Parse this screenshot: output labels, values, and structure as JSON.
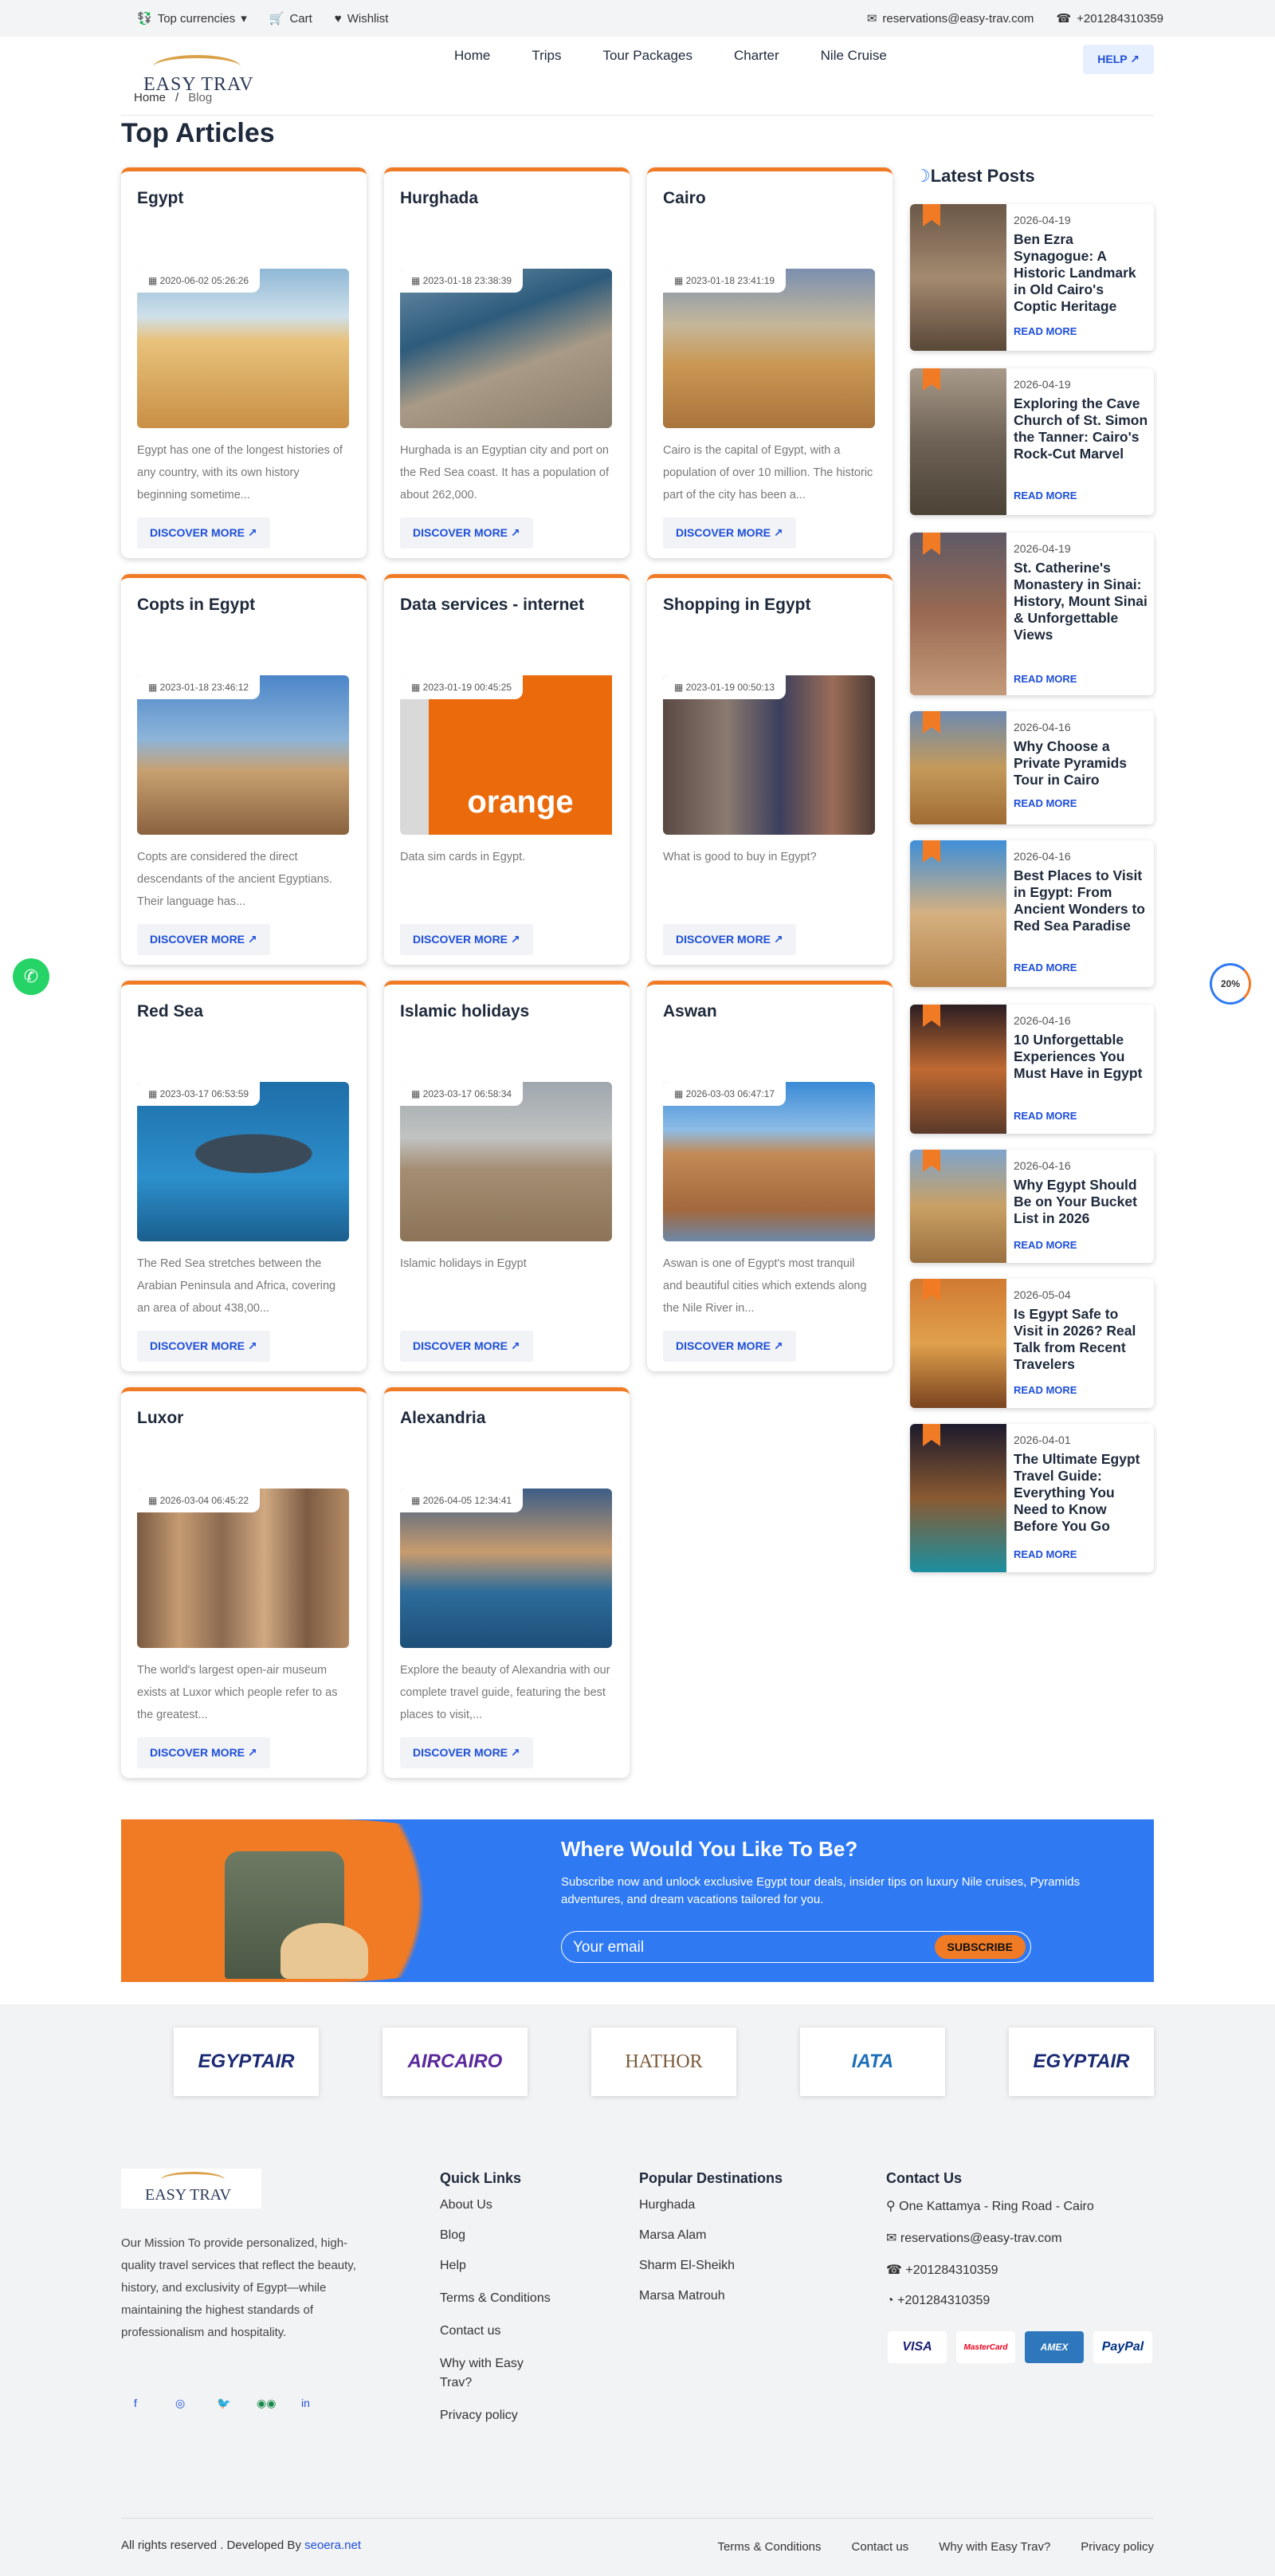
{
  "topbar": {
    "currencies": "Top currencies",
    "cart": "Cart",
    "wishlist": "Wishlist",
    "email": "reservations@easy-trav.com",
    "phone": "+201284310359"
  },
  "brand": {
    "name": "EASY TRAV"
  },
  "nav": [
    "Home",
    "Trips",
    "Tour Packages",
    "Charter",
    "Nile Cruise"
  ],
  "help_label": "HELP",
  "breadcrumb": {
    "home": "Home",
    "sep": "/",
    "current": "Blog"
  },
  "page_title": "Top Articles",
  "cards": [
    {
      "title": "Egypt",
      "date": "2020-06-02 05:26:26",
      "desc": "Egypt has one of the longest histories of any country, with its own history beginning sometime...",
      "btn": "DISCOVER MORE"
    },
    {
      "title": "Hurghada",
      "date": "2023-01-18 23:38:39",
      "desc": "Hurghada is an Egyptian city and port on the Red Sea coast. It has a population of about 262,000.",
      "btn": "DISCOVER MORE"
    },
    {
      "title": "Cairo",
      "date": "2023-01-18 23:41:19",
      "desc": "Cairo is the capital of Egypt, with a population of over 10 million. The historic part of the city has been a...",
      "btn": "DISCOVER MORE"
    },
    {
      "title": "Copts in Egypt",
      "date": "2023-01-18 23:46:12",
      "desc": "Copts are considered the direct descendants of the ancient Egyptians. Their language has...",
      "btn": "DISCOVER MORE"
    },
    {
      "title": "Data services - internet",
      "date": "2023-01-19 00:45:25",
      "desc": "Data sim cards in Egypt.",
      "btn": "DISCOVER MORE"
    },
    {
      "title": "Shopping in Egypt",
      "date": "2023-01-19 00:50:13",
      "desc": "What is good to buy in Egypt?",
      "btn": "DISCOVER MORE"
    },
    {
      "title": "Red Sea",
      "date": "2023-03-17 06:53:59",
      "desc": "The Red Sea stretches between the Arabian Peninsula and Africa, covering an area of about 438,00...",
      "btn": "DISCOVER MORE"
    },
    {
      "title": "Islamic holidays",
      "date": "2023-03-17 06:58:34",
      "desc": "Islamic holidays in Egypt",
      "btn": "DISCOVER MORE"
    },
    {
      "title": "Aswan",
      "date": "2026-03-03 06:47:17",
      "desc": "Aswan is one of Egypt's most tranquil and beautiful cities which extends along the Nile River in...",
      "btn": "DISCOVER MORE"
    },
    {
      "title": "Luxor",
      "date": "2026-03-04 06:45:22",
      "desc": "The world's largest open-air museum exists at Luxor which people refer to as the greatest...",
      "btn": "DISCOVER MORE"
    },
    {
      "title": "Alexandria",
      "date": "2026-04-05 12:34:41",
      "desc": "Explore the beauty of Alexandria with our complete travel guide, featuring the best places to visit,...",
      "btn": "DISCOVER MORE"
    }
  ],
  "orange_logo_text": "orange",
  "latest": {
    "title": "Latest Posts",
    "read_more": "READ MORE",
    "posts": [
      {
        "date": "2026-04-19",
        "title": "Ben Ezra Synagogue: A Historic Landmark in Old Cairo's Coptic Heritage"
      },
      {
        "date": "2026-04-19",
        "title": "Exploring the Cave Church of St. Simon the Tanner: Cairo's Rock-Cut Marvel"
      },
      {
        "date": "2026-04-19",
        "title": "St. Catherine's Monastery in Sinai: History, Mount Sinai & Unforgettable Views"
      },
      {
        "date": "2026-04-16",
        "title": "Why Choose a Private Pyramids Tour in Cairo"
      },
      {
        "date": "2026-04-16",
        "title": "Best Places to Visit in Egypt: From Ancient Wonders to Red Sea Paradise"
      },
      {
        "date": "2026-04-16",
        "title": "10 Unforgettable Experiences You Must Have in Egypt"
      },
      {
        "date": "2026-04-16",
        "title": "Why Egypt Should Be on Your Bucket List in 2026"
      },
      {
        "date": "2026-05-04",
        "title": "Is Egypt Safe to Visit in 2026? Real Talk from Recent Travelers"
      },
      {
        "date": "2026-04-01",
        "title": "The Ultimate Egypt Travel Guide: Everything You Need to Know Before You Go"
      }
    ]
  },
  "newsletter": {
    "title": "Where Would You Like To Be?",
    "text": "Subscribe now and unlock exclusive Egypt tour deals, insider tips on luxury Nile cruises, Pyramids adventures, and dream vacations tailored for you.",
    "placeholder": "Your email",
    "button": "SUBSCRIBE"
  },
  "partners": [
    "EGYPTAIR",
    "AIRCAIRO",
    "HATHOR",
    "IATA",
    "EGYPTAIR"
  ],
  "footer": {
    "mission": "Our Mission To provide personalized, high-quality travel services that reflect the beauty, history, and exclusivity of Egypt—while maintaining the highest standards of professionalism and hospitality.",
    "quick_title": "Quick Links",
    "quick": [
      "About Us",
      "Blog",
      "Help",
      "Terms & Conditions",
      "Contact us",
      "Why with Easy Trav?",
      "Privacy policy"
    ],
    "dest_title": "Popular Destinations",
    "dest": [
      "Hurghada",
      "Marsa Alam",
      "Sharm El-Sheikh",
      "Marsa Matrouh"
    ],
    "contact_title": "Contact Us",
    "address": "One Kattamya - Ring Road - Cairo",
    "email": "reservations@easy-trav.com",
    "phone": "+201284310359",
    "whatsapp": "+201284310359",
    "payments": [
      "VISA",
      "MasterCard",
      "AMEX",
      "PayPal"
    ],
    "copyright": "All rights reserved . Developed By",
    "developer": "seoera.net",
    "bottom_links": [
      "Terms & Conditions",
      "Contact us",
      "Why with Easy Trav?",
      "Privacy policy"
    ]
  },
  "scroll_progress": "20%",
  "colors": {
    "accent": "#f17b25",
    "primary": "#2f7af2",
    "link": "#1d4ed8"
  }
}
